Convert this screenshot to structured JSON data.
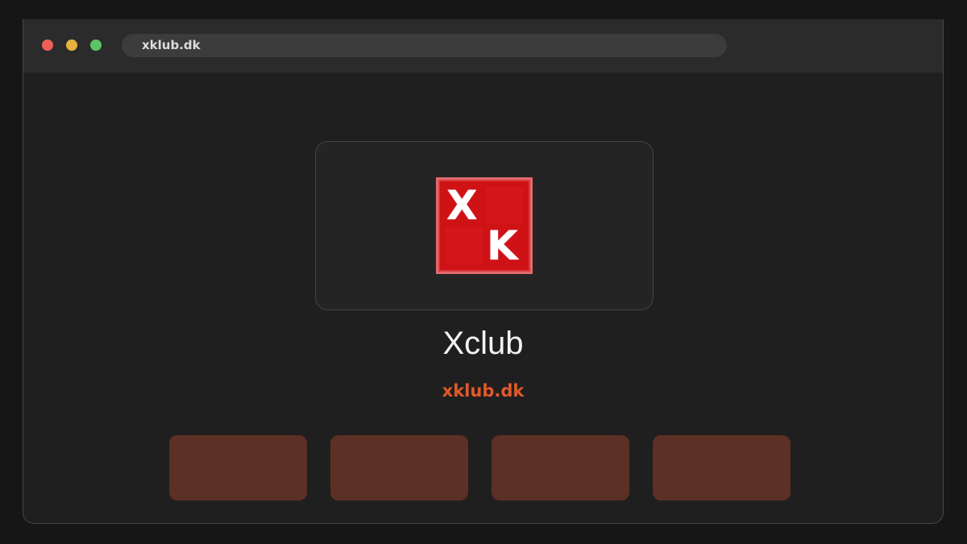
{
  "browser": {
    "url": "xklub.dk"
  },
  "site": {
    "title": "Xclub",
    "domain": "xklub.dk",
    "logo": {
      "letter_top": "X",
      "letter_bottom": "K",
      "color": "#cf1216"
    }
  },
  "colors": {
    "accent": "#e05a2b",
    "tile": "#5c3024",
    "background": "#1f1f1f"
  },
  "tiles": [
    {
      "label": ""
    },
    {
      "label": ""
    },
    {
      "label": ""
    },
    {
      "label": ""
    }
  ]
}
